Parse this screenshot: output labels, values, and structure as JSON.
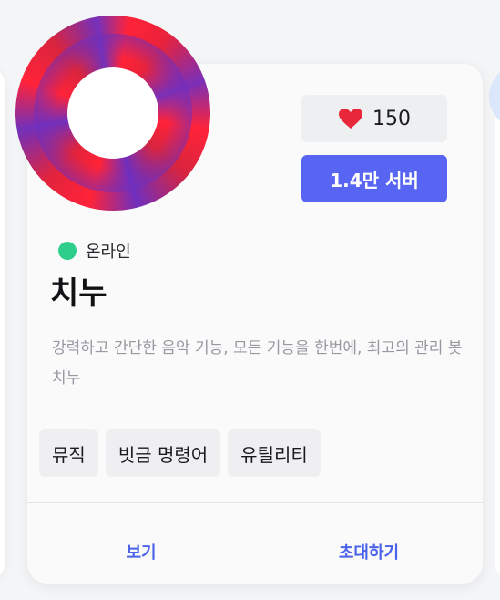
{
  "bot": {
    "name": "치누",
    "status": "온라인",
    "likes": "150",
    "servers": "1.4만 서버",
    "description": "강력하고 간단한 음악 기능, 모든 기능을 한번에, 최고의 관리 봇 치누",
    "tags": [
      "뮤직",
      "빗금 명령어",
      "유틸리티"
    ]
  },
  "actions": {
    "view_label": "보기",
    "invite_label": "초대하기"
  },
  "colors": {
    "accent": "#5865f2",
    "online": "#2dcd8b",
    "heart": "#e8283a",
    "link": "#4b63e8"
  },
  "icons": {
    "likes": "heart-icon"
  }
}
